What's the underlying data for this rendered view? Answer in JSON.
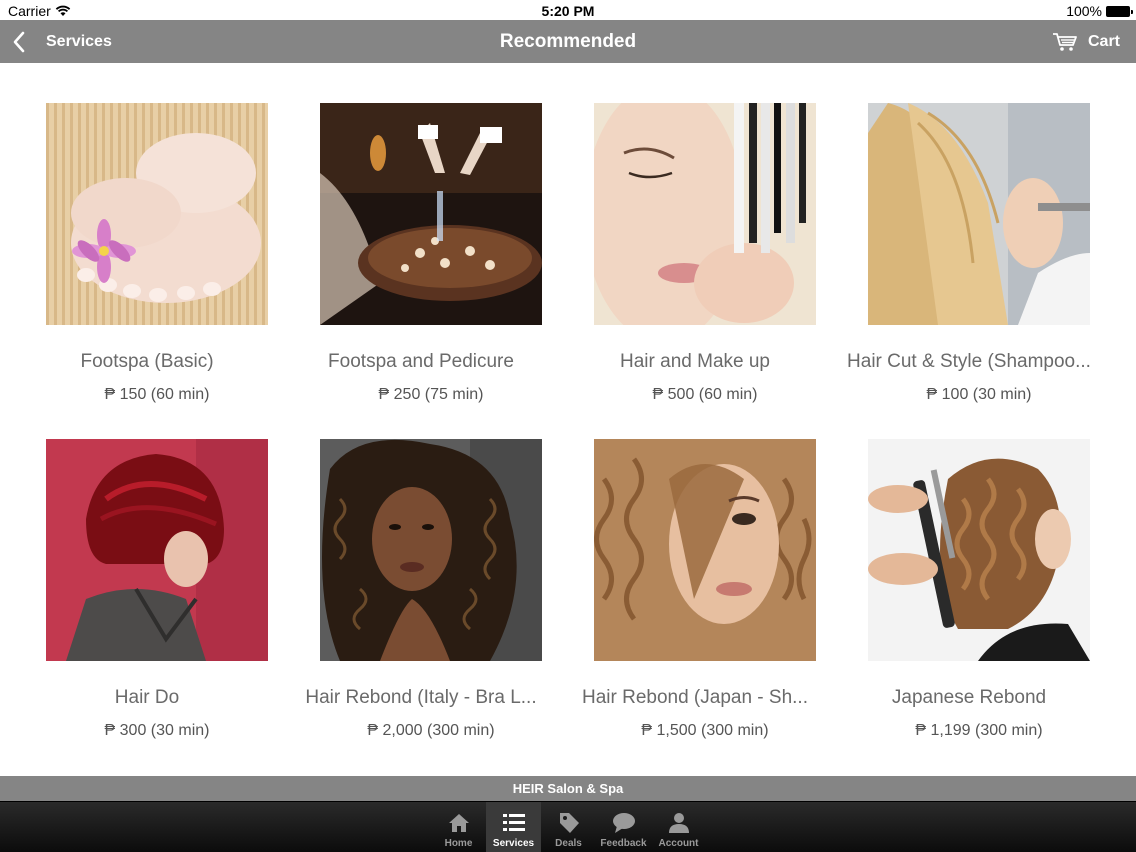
{
  "status_bar": {
    "carrier": "Carrier",
    "time": "5:20 PM",
    "battery": "100%",
    "icons": [
      "wifi-icon",
      "battery-icon"
    ]
  },
  "nav": {
    "back_label": "Services",
    "title": "Recommended",
    "cart_label": "Cart",
    "icons": [
      "chevron-left-icon",
      "cart-icon"
    ]
  },
  "services": [
    {
      "name": "Footspa (Basic)",
      "price": "₱ 150 (60 min)"
    },
    {
      "name": "Footspa and Pedicure",
      "price": "₱ 250 (75 min)"
    },
    {
      "name": "Hair and Make up",
      "price": "₱ 500 (60 min)"
    },
    {
      "name": "Hair Cut & Style (Shampoo...",
      "price": "₱ 100 (30 min)"
    },
    {
      "name": "Hair Do",
      "price": "₱ 300 (30 min)"
    },
    {
      "name": "Hair Rebond (Italy - Bra L...",
      "price": "₱ 2,000 (300 min)"
    },
    {
      "name": "Hair Rebond (Japan - Sh...",
      "price": "₱ 1,500 (300 min)"
    },
    {
      "name": "Japanese Rebond",
      "price": "₱ 1,199 (300 min)"
    }
  ],
  "footer": {
    "label": "HEIR Salon & Spa"
  },
  "tabs": [
    {
      "label": "Home",
      "icon": "home-icon"
    },
    {
      "label": "Services",
      "icon": "list-icon"
    },
    {
      "label": "Deals",
      "icon": "tag-icon"
    },
    {
      "label": "Feedback",
      "icon": "speech-bubble-icon"
    },
    {
      "label": "Account",
      "icon": "person-icon"
    }
  ],
  "colors": {
    "bar_gray": "#858585",
    "tab_bar": "#111111",
    "text_gray": "#6a6a6a"
  }
}
